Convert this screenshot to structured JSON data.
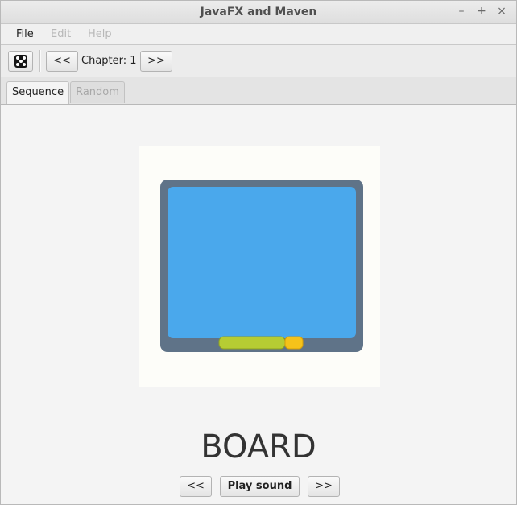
{
  "window": {
    "title": "JavaFX and Maven",
    "minimize_glyph": "–",
    "maximize_glyph": "+",
    "close_glyph": "×"
  },
  "menu": {
    "items": [
      {
        "label": "File",
        "enabled": true
      },
      {
        "label": "Edit",
        "enabled": false
      },
      {
        "label": "Help",
        "enabled": false
      }
    ]
  },
  "toolbar": {
    "random_icon": "dice-icon",
    "prev_label": "<<",
    "chapter_label": "Chapter: 1",
    "next_label": ">>"
  },
  "tabs": [
    {
      "label": "Sequence",
      "active": true
    },
    {
      "label": "Random",
      "active": false
    }
  ],
  "card": {
    "image_icon": "blackboard-icon",
    "word": "BOARD",
    "prev_label": "<<",
    "play_label": "Play sound",
    "next_label": ">>"
  },
  "colors": {
    "board_fill": "#4aa8ec",
    "board_frame": "#5f7388",
    "chalk_green": "#b6cc33",
    "chalk_yellow": "#f5c21a"
  }
}
